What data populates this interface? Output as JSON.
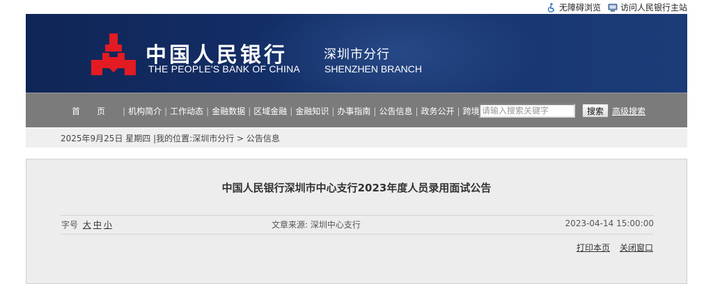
{
  "top_links": {
    "accessible": "无障碍浏览",
    "main_site": "访问人民银行主站"
  },
  "banner": {
    "cn_name": "中国人民银行",
    "cn_branch": "深圳市分行",
    "en_name": "THE PEOPLE'S BANK OF CHINA",
    "en_branch": "SHENZHEN BRANCH",
    "logo_color": "#e31b23"
  },
  "nav": {
    "items": [
      "首页",
      "机构简介",
      "工作动态",
      "金融数据",
      "区域金融",
      "金融知识",
      "办事指南",
      "公告信息",
      "政务公开",
      "跨境理财通"
    ],
    "search_placeholder": "请输入搜索关键字",
    "search_button": "搜索",
    "advanced_search": "高级搜索"
  },
  "breadcrumb": {
    "date": "2025年9月25日 星期四",
    "separator": "|",
    "location_label": "我的位置:",
    "path": [
      "深圳市分行",
      "公告信息"
    ],
    "arrow": ">"
  },
  "article": {
    "title": "中国人民银行深圳市中心支行2023年度人员录用面试公告",
    "font_size_label": "字号",
    "font_sizes": [
      "大",
      "中",
      "小"
    ],
    "source_label": "文章来源:",
    "source": "深圳中心支行",
    "date": "2023-04-14 15:00:00",
    "print": "打印本页",
    "close": "关闭窗口"
  }
}
